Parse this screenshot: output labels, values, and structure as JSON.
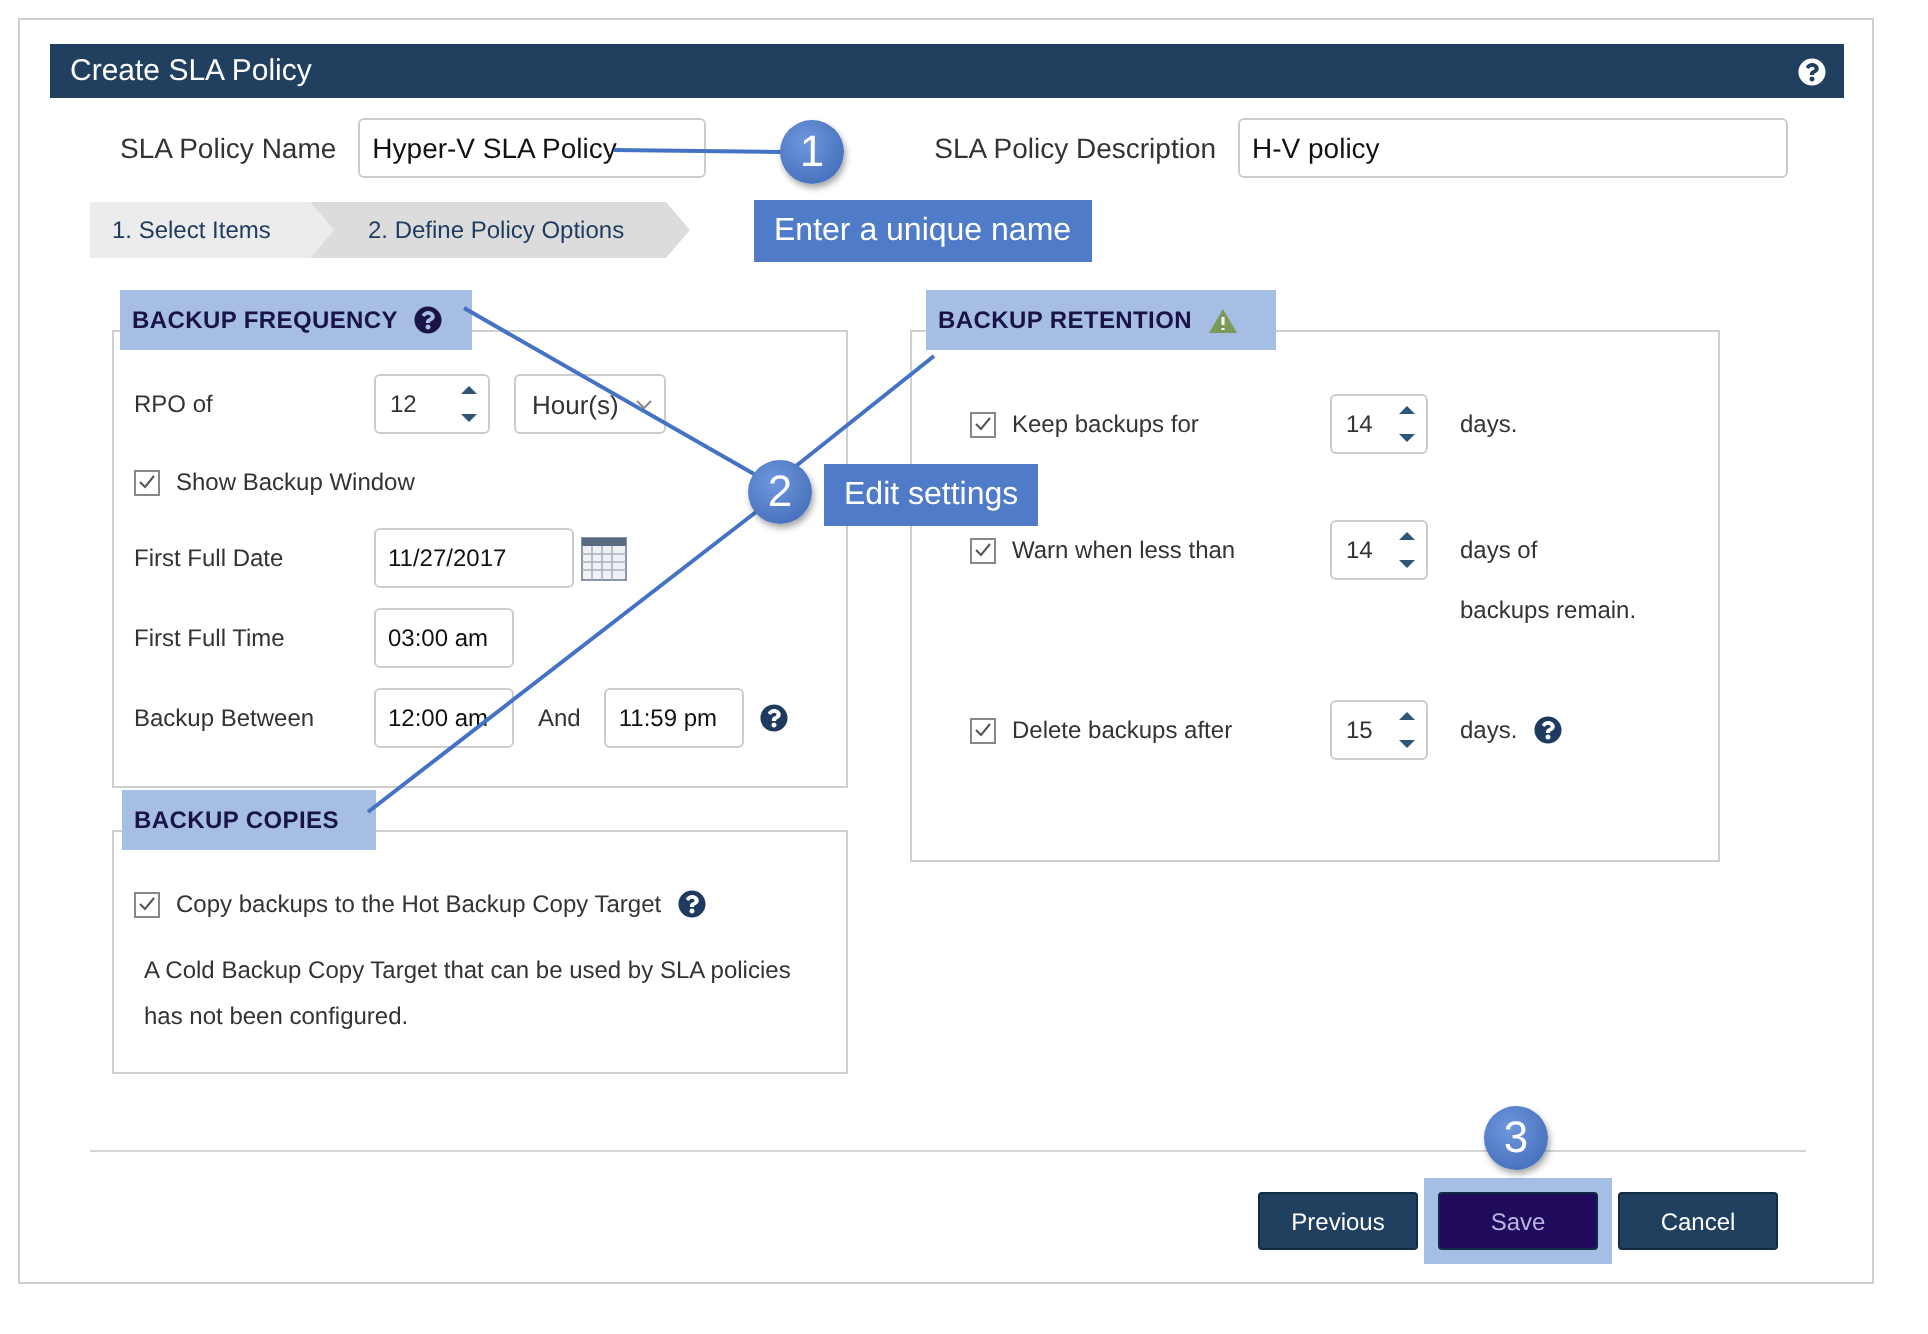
{
  "dialog": {
    "title": "Create SLA Policy"
  },
  "fields": [
    {
      "label": "SLA Policy Name",
      "value": "Hyper-V SLA Policy"
    },
    {
      "label": "SLA Policy Description",
      "value": "H-V policy"
    }
  ],
  "steps": [
    {
      "label": "1. Select Items",
      "selected": false
    },
    {
      "label": "2. Define Policy Options",
      "selected": true
    }
  ],
  "backup_frequency": {
    "title": "BACKUP FREQUENCY",
    "highlighted": true,
    "rpo": {
      "label": "RPO of",
      "value": "12",
      "unit": "Hour(s)"
    },
    "show_window": {
      "label": "Show Backup Window",
      "checked": true
    },
    "first_full_date": {
      "label": "First Full Date",
      "value": "11/27/2017"
    },
    "first_full_time": {
      "label": "First Full Time",
      "value": "03:00 am"
    },
    "backup_between": {
      "label": "Backup Between",
      "from": "12:00 am",
      "and": "And",
      "to": "11:59 pm"
    }
  },
  "backup_copies": {
    "title": "BACKUP COPIES",
    "highlighted": true,
    "hot_copy": {
      "label": "Copy backups to the Hot Backup Copy Target",
      "checked": true
    },
    "cold_note": "A Cold Backup Copy Target that can be used by SLA policies has not been configured."
  },
  "backup_retention": {
    "title": "BACKUP RETENTION",
    "highlighted": true,
    "rows": [
      {
        "label": "Keep backups for",
        "checked": true,
        "value": "14",
        "suffix": [
          "days."
        ],
        "help": false
      },
      {
        "label": "Warn when less than",
        "checked": true,
        "value": "14",
        "suffix": [
          "days of",
          "backups remain."
        ],
        "help": false
      },
      {
        "label": "Delete backups after",
        "checked": true,
        "value": "15",
        "suffix": [
          "days."
        ],
        "help": true
      }
    ]
  },
  "buttons": [
    {
      "label": "Previous",
      "primary": false,
      "highlighted": false
    },
    {
      "label": "Save",
      "primary": true,
      "highlighted": true
    },
    {
      "label": "Cancel",
      "primary": false,
      "highlighted": false
    }
  ],
  "callouts": [
    {
      "number": "1",
      "text": "Enter a unique name"
    },
    {
      "number": "2",
      "text": "Edit settings"
    },
    {
      "number": "3"
    }
  ]
}
